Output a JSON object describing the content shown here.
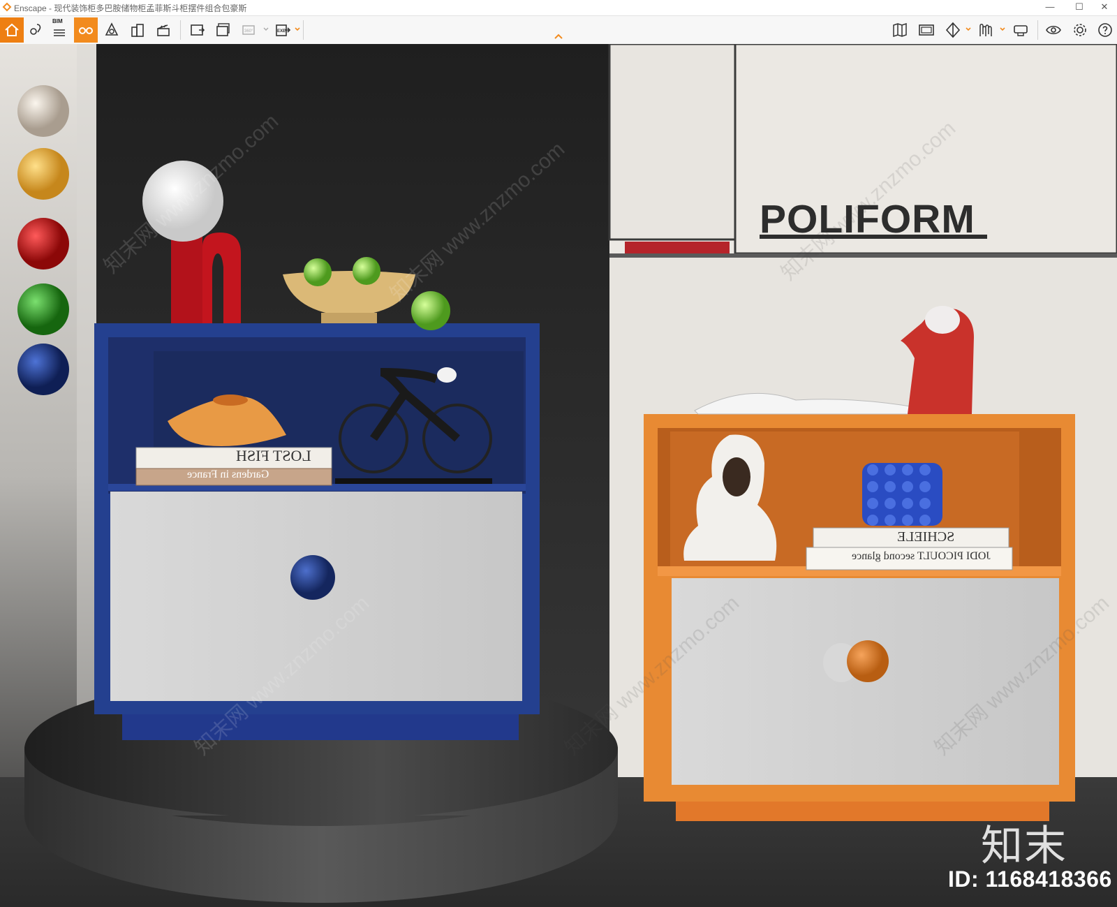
{
  "window": {
    "title": "Enscape - 现代装饰柜多巴胺储物柜孟菲斯斗柜摆件组合包豪斯",
    "controls": {
      "minimize": "—",
      "maximize": "☐",
      "close": "✕"
    }
  },
  "toolbar": {
    "left_tools": [
      "home-icon",
      "location-pin-icon",
      "bim-icon",
      "binoculars-icon",
      "asset-library-icon",
      "buildings-icon",
      "clapperboard-icon",
      "screenshot-icon",
      "batch-render-icon",
      "panorama-icon",
      "export-exe-icon"
    ],
    "bim_label": "BIM",
    "panorama_label": "360°",
    "exe_label": "EXE",
    "right_tools": [
      "map-icon",
      "display-icon",
      "cube-icon",
      "visual-settings-icon",
      "vr-headset-icon",
      "eye-icon",
      "gear-icon",
      "help-icon"
    ],
    "accent": "#f28b1e"
  },
  "swatches": [
    "#d9cfc2",
    "#f0b83a",
    "#d61616",
    "#2da12a",
    "#1f3c8f"
  ],
  "scene": {
    "brand_text": "POLIFORM",
    "book_left_top": "LOST FISH",
    "book_left_bottom": "Gardens in France",
    "book_right_top": "SCHIELE",
    "book_right_bottom": "JODI PICOULT  second glance",
    "watermark_text": "知末网 www.znzmo.com",
    "logo_text": "知末",
    "id_text": "ID: 1168418366"
  }
}
